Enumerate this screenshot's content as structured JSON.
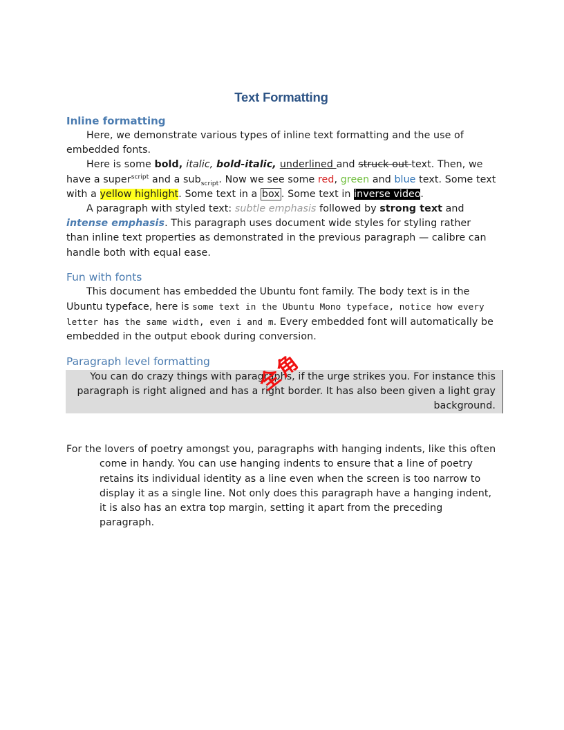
{
  "title": "Text Formatting",
  "sections": {
    "inline": {
      "heading": "Inline formatting",
      "p1": "Here, we demonstrate various types of inline text formatting and the use of embedded fonts.",
      "p2": {
        "t1": "Here is some ",
        "bold": "bold",
        "c1": ", ",
        "italic": "italic",
        "c2": ", ",
        "bold_italic": "bold-italic",
        "c3": ", ",
        "underlined": "underlined ",
        "t2": "and ",
        "struck": "struck out ",
        "t3": "text. Then, we have a super",
        "sup": "script",
        "t4": " and a sub",
        "sub": "script",
        "t5": ". Now we see some ",
        "red": "red",
        "c4": ", ",
        "green": "green",
        "t6": " and ",
        "blue": "blue",
        "t7": " text. Some text with a ",
        "highlight": "yellow highlight",
        "t8": ". Some text in a ",
        "box": "box",
        "t9": ". Some text in ",
        "inverse": "inverse video",
        "t10": "."
      },
      "p3": {
        "t1": "A paragraph with styled text: ",
        "subtle": "subtle emphasis",
        "t2": " followed by ",
        "strong": "strong text",
        "t3": " and ",
        "intense": "intense emphasis",
        "t4": ". This paragraph uses document wide styles for styling rather than inline text properties as demonstrated in the previous paragraph — calibre can handle both with equal ease."
      }
    },
    "fonts": {
      "heading": "Fun with fonts",
      "t1": "This document has embedded the Ubuntu font family. The body text is in the Ubuntu typeface, here is ",
      "mono": "some text in the Ubuntu Mono typeface, notice how every letter has the same width, even i and m",
      "t2": ". Every embedded font will automatically be embedded in the output ebook during conversion."
    },
    "paragraph": {
      "heading": "Paragraph level formatting",
      "right_aligned": "You can do crazy things with paragraphs, if the urge strikes you. For instance this paragraph is right aligned and has a right border. It has also been given a light gray background.",
      "poetry": "For the lovers of poetry amongst you, paragraphs with hanging indents, like this often come in handy. You can use hanging indents to ensure that a line of poetry retains its individual identity as a line even when the screen is too narrow to display it as a single line. Not only does this paragraph have a hanging indent, it is also has an extra top margin, setting it apart from the preceding paragraph."
    }
  },
  "stamp": {
    "char1": "全",
    "char2": "角"
  },
  "colors": {
    "title": "#2c5385",
    "heading": "#4a7bb0",
    "red": "#d42020",
    "green": "#6fbe3c",
    "blue": "#2a6fb3",
    "highlight": "#ffff1c",
    "stamp": "#f01010"
  }
}
